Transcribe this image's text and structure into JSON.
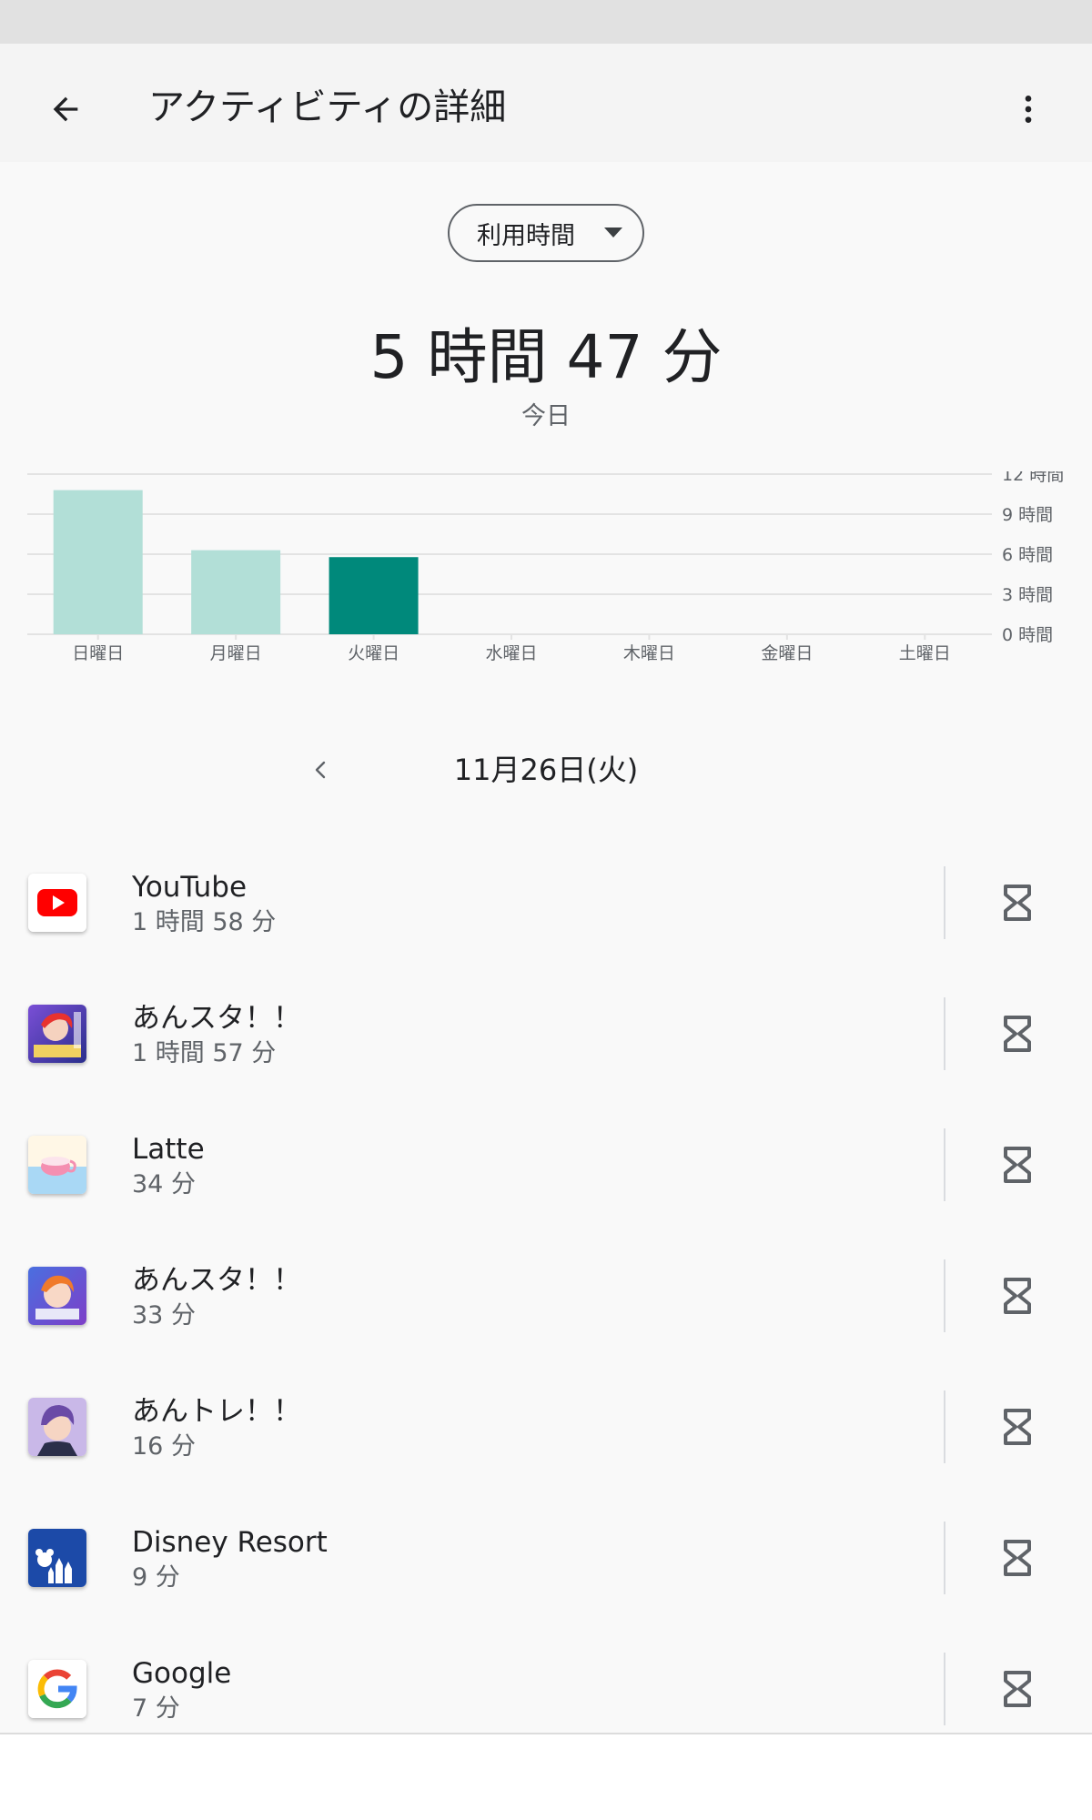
{
  "header": {
    "title": "アクティビティの詳細",
    "back_icon": "arrow-back-icon",
    "more_icon": "more-vert-icon"
  },
  "metric_dropdown": {
    "selected": "利用時間"
  },
  "summary": {
    "total": "5 時間 47 分",
    "period": "今日"
  },
  "chart_data": {
    "type": "bar",
    "categories": [
      "日曜日",
      "月曜日",
      "火曜日",
      "水曜日",
      "木曜日",
      "金曜日",
      "土曜日"
    ],
    "values": [
      10.8,
      6.3,
      5.78,
      0,
      0,
      0,
      0
    ],
    "unit": "時間",
    "selected_index": 2,
    "ylim": [
      0,
      12
    ],
    "yticks": [
      0,
      3,
      6,
      9,
      12
    ],
    "ytick_labels": [
      "0 時間",
      "3 時間",
      "6 時間",
      "9 時間",
      "12 時間"
    ],
    "colors": {
      "bar": "#b2dfd7",
      "selected_bar": "#00897b",
      "grid": "#e3e3e3"
    },
    "grid": true
  },
  "date_nav": {
    "date": "11月26日(火)",
    "prev_icon": "chevron-left-icon"
  },
  "apps": [
    {
      "name": "YouTube",
      "time": "1 時間 58 分",
      "icon": "youtube-icon"
    },
    {
      "name": "あんスタ！！",
      "time": "1 時間 57 分",
      "icon": "enstars-music-icon"
    },
    {
      "name": "Latte",
      "time": "34 分",
      "icon": "latte-icon"
    },
    {
      "name": "あんスタ！！",
      "time": "33 分",
      "icon": "enstars-basic-icon"
    },
    {
      "name": "あんトレ！！",
      "time": "16 分",
      "icon": "antore-icon"
    },
    {
      "name": "Disney Resort",
      "time": "9 分",
      "icon": "disney-resort-icon"
    },
    {
      "name": "Google",
      "time": "7 分",
      "icon": "google-icon"
    }
  ]
}
